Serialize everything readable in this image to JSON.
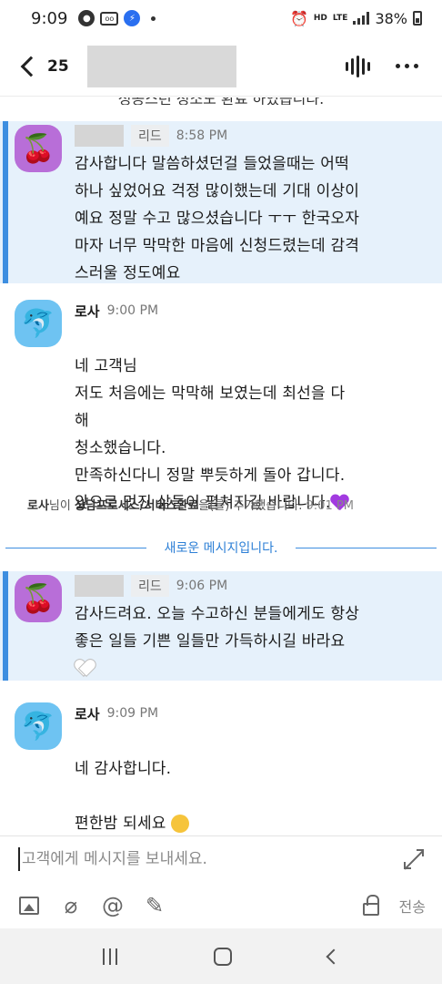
{
  "status_bar": {
    "time": "9:09",
    "network_hd": "HD",
    "network_lte": "LTE",
    "battery": "38%"
  },
  "header": {
    "back_count": "25",
    "icons": [
      "back-chevron-icon",
      "voice-icon",
      "more-icon"
    ]
  },
  "chat": {
    "cut_text": "성공스런 청소도 환료 하였습니다.",
    "messages": [
      {
        "role": "리드",
        "time": "8:58 PM",
        "avatar": "🍒",
        "text": "감사합니다 말씀하셨던걸 들었을때는 어떡\n하나 싶었어요 걱정 많이했는데 기대 이상이\n예요 정말 수고 많으셨습니다 ㅜㅜ 한국오자\n마자 너무 막막한 마음에 신청드렸는데 감격\n스러울 정도예요"
      },
      {
        "sender": "로사",
        "time": "9:00 PM",
        "avatar": "🐬",
        "text": "네 고객님\n저도 처음에는 막막해 보였는데  최선을 다\n해\n청소했습니다.\n만족하신다니 정말 뿌듯하게 돌아 갑니다.\n앞으로 멋진 삶들이 펼쳐지길 바랍니다."
      },
      {
        "role": "리드",
        "time": "9:06 PM",
        "avatar": "🍒",
        "text": "감사드려요. 오늘 수고하신 분들에게도 항상\n좋은 일들 기쁜 일들만 가득하시길 바라요"
      },
      {
        "sender": "로사",
        "time": "9:09 PM",
        "avatar": "🐬",
        "text_line1": "네 감사합니다.",
        "text_line2": "편한밤 되세요"
      }
    ],
    "system_note": {
      "actor": "로사",
      "middle": "님이 ",
      "tag": "상담프로세스/서비스완료",
      "suffix": "을(를) 추가했습니다.",
      "time": "9:01 PM"
    },
    "new_divider": "새로운 메시지입니다."
  },
  "composer": {
    "placeholder": "고객에게 메시지를 보내세요.",
    "send_label": "전송",
    "icons": [
      "image-icon",
      "attach-icon",
      "mention-icon",
      "note-icon",
      "lock-icon",
      "expand-icon"
    ]
  }
}
